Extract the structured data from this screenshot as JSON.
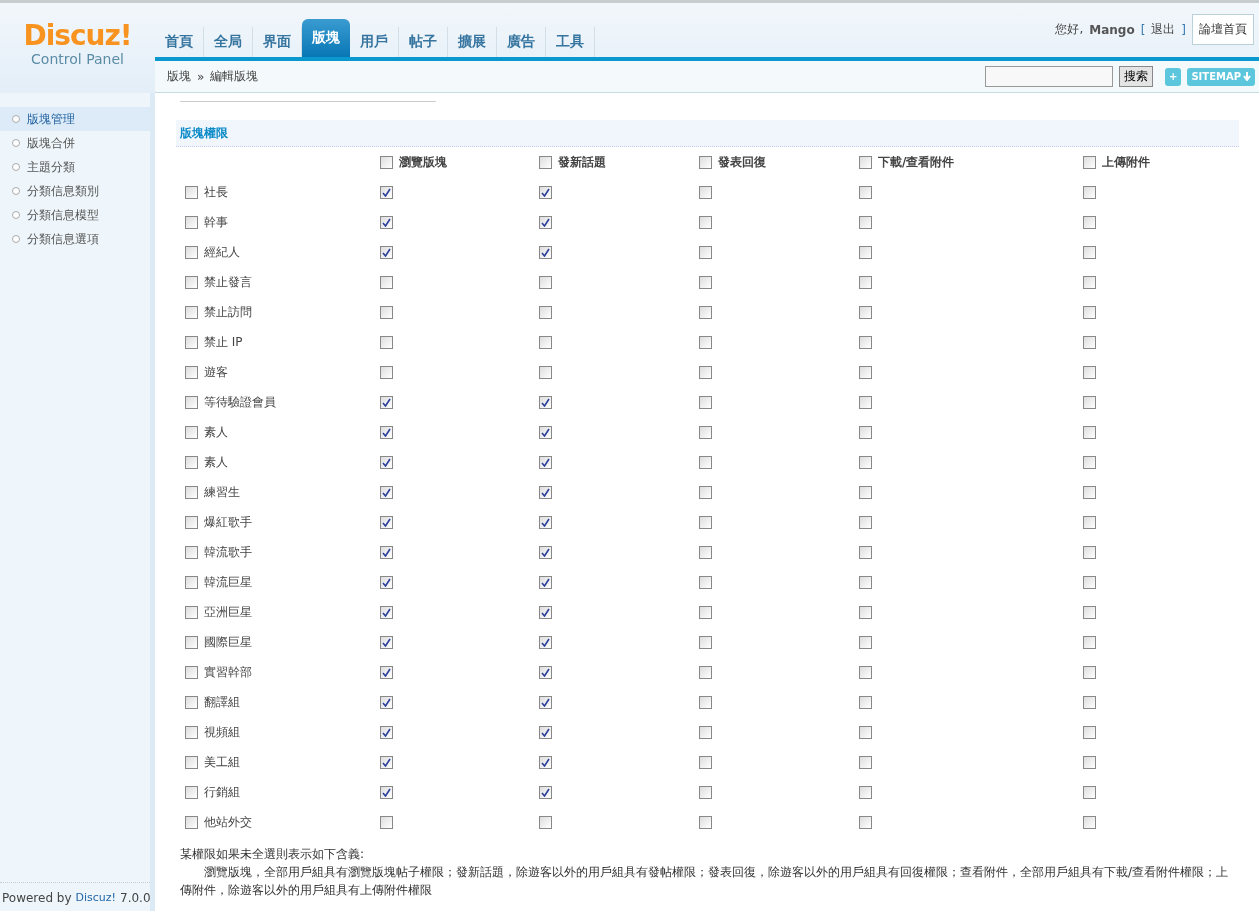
{
  "logo": {
    "brand": "Discuz!",
    "subtitle": "Control Panel"
  },
  "nav": [
    {
      "label": "首頁",
      "selected": false
    },
    {
      "label": "全局",
      "selected": false
    },
    {
      "label": "界面",
      "selected": false
    },
    {
      "label": "版塊",
      "selected": true
    },
    {
      "label": "用戶",
      "selected": false
    },
    {
      "label": "帖子",
      "selected": false
    },
    {
      "label": "擴展",
      "selected": false
    },
    {
      "label": "廣告",
      "selected": false
    },
    {
      "label": "工具",
      "selected": false
    }
  ],
  "user": {
    "greeting": "您好,",
    "name": "Mango",
    "logout_open": "[",
    "logout": "退出",
    "logout_close": "]",
    "home_button": "論壇首頁"
  },
  "breadcrumb": {
    "parent": "版塊",
    "separator": "»",
    "current": "編輯版塊"
  },
  "search": {
    "button": "搜索",
    "add": "+",
    "sitemap": "SITEMAP"
  },
  "sidebar": {
    "items": [
      {
        "label": "版塊管理",
        "selected": true
      },
      {
        "label": "版塊合併",
        "selected": false
      },
      {
        "label": "主題分類",
        "selected": false
      },
      {
        "label": "分類信息類別",
        "selected": false
      },
      {
        "label": "分類信息模型",
        "selected": false
      },
      {
        "label": "分類信息選項",
        "selected": false
      }
    ],
    "powered_by": "Powered by",
    "brand": "Discuz!",
    "version": "7.0.0"
  },
  "section_title": "版塊權限",
  "columns": [
    {
      "label": "瀏覽版塊",
      "checked": false
    },
    {
      "label": "發新話題",
      "checked": false
    },
    {
      "label": "發表回復",
      "checked": false
    },
    {
      "label": "下載/查看附件",
      "checked": false
    },
    {
      "label": "上傳附件",
      "checked": false
    }
  ],
  "groups": [
    {
      "label": "社長",
      "checked": false,
      "permissions": [
        true,
        true,
        false,
        false,
        false
      ]
    },
    {
      "label": "幹事",
      "checked": false,
      "permissions": [
        true,
        true,
        false,
        false,
        false
      ]
    },
    {
      "label": "經紀人",
      "checked": false,
      "permissions": [
        true,
        true,
        false,
        false,
        false
      ]
    },
    {
      "label": "禁止發言",
      "checked": false,
      "permissions": [
        false,
        false,
        false,
        false,
        false
      ]
    },
    {
      "label": "禁止訪問",
      "checked": false,
      "permissions": [
        false,
        false,
        false,
        false,
        false
      ]
    },
    {
      "label": "禁止 IP",
      "checked": false,
      "permissions": [
        false,
        false,
        false,
        false,
        false
      ]
    },
    {
      "label": "遊客",
      "checked": false,
      "permissions": [
        false,
        false,
        false,
        false,
        false
      ]
    },
    {
      "label": "等待驗證會員",
      "checked": false,
      "permissions": [
        true,
        true,
        false,
        false,
        false
      ]
    },
    {
      "label": "素人",
      "checked": false,
      "permissions": [
        true,
        true,
        false,
        false,
        false
      ]
    },
    {
      "label": "素人",
      "checked": false,
      "permissions": [
        true,
        true,
        false,
        false,
        false
      ]
    },
    {
      "label": "練習生",
      "checked": false,
      "permissions": [
        true,
        true,
        false,
        false,
        false
      ]
    },
    {
      "label": "爆紅歌手",
      "checked": false,
      "permissions": [
        true,
        true,
        false,
        false,
        false
      ]
    },
    {
      "label": "韓流歌手",
      "checked": false,
      "permissions": [
        true,
        true,
        false,
        false,
        false
      ]
    },
    {
      "label": "韓流巨星",
      "checked": false,
      "permissions": [
        true,
        true,
        false,
        false,
        false
      ]
    },
    {
      "label": "亞洲巨星",
      "checked": false,
      "permissions": [
        true,
        true,
        false,
        false,
        false
      ]
    },
    {
      "label": "國際巨星",
      "checked": false,
      "permissions": [
        true,
        true,
        false,
        false,
        false
      ]
    },
    {
      "label": "實習幹部",
      "checked": false,
      "permissions": [
        true,
        true,
        false,
        false,
        false
      ]
    },
    {
      "label": "翻譯組",
      "checked": false,
      "permissions": [
        true,
        true,
        false,
        false,
        false
      ]
    },
    {
      "label": "視頻組",
      "checked": false,
      "permissions": [
        true,
        true,
        false,
        false,
        false
      ]
    },
    {
      "label": "美工組",
      "checked": false,
      "permissions": [
        true,
        true,
        false,
        false,
        false
      ]
    },
    {
      "label": "行銷組",
      "checked": false,
      "permissions": [
        true,
        true,
        false,
        false,
        false
      ]
    },
    {
      "label": "他站外交",
      "checked": false,
      "permissions": [
        false,
        false,
        false,
        false,
        false
      ]
    }
  ],
  "notes": {
    "heading": "某權限如果未全選則表示如下含義:",
    "body": "瀏覽版塊，全部用戶組具有瀏覽版塊帖子權限；發新話題，除遊客以外的用戶組具有發帖權限；發表回復，除遊客以外的用戶組具有回復權限；查看附件，全部用戶組具有下載/查看附件權限；上傳附件，除遊客以外的用戶組具有上傳附件權限"
  }
}
